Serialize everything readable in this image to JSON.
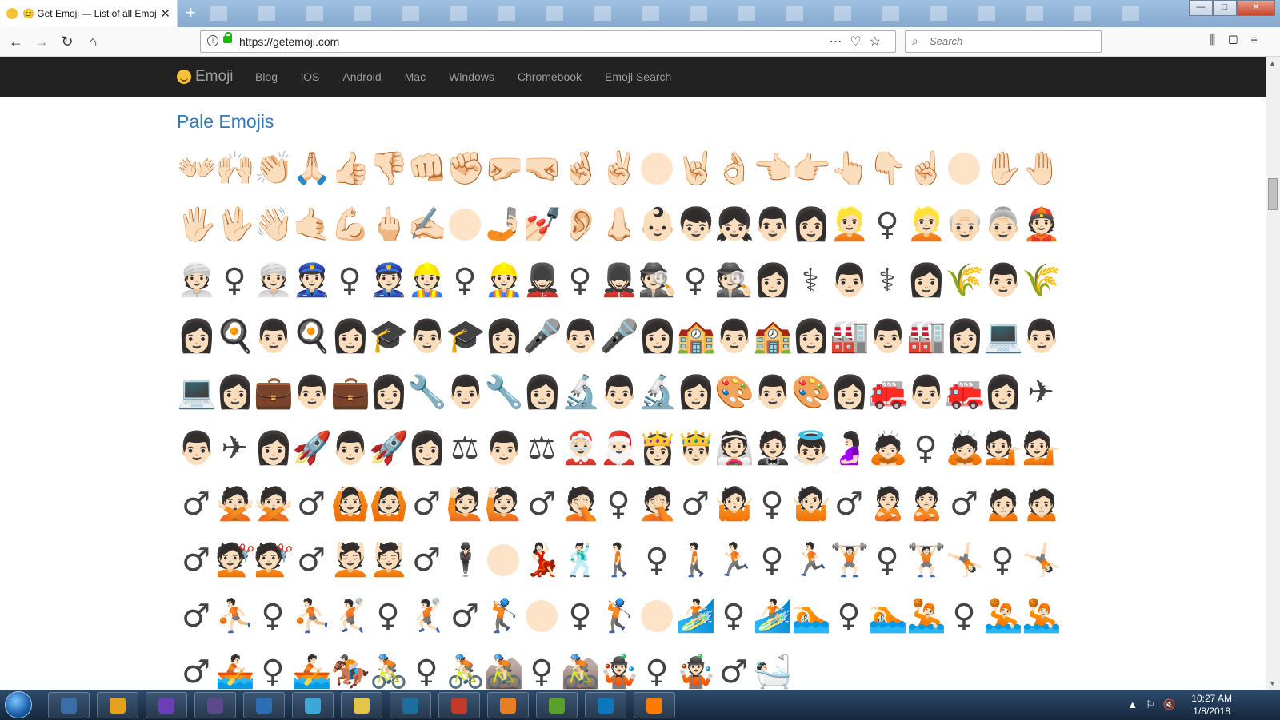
{
  "browser": {
    "tab_title": "😊 Get Emoji — List of all Emoji",
    "new_tab_label": "+",
    "url_host": "https://getemoji.com",
    "search_placeholder": "Search",
    "window_controls": [
      "—",
      "□",
      "✕"
    ]
  },
  "site": {
    "brand": "Emoji",
    "nav": [
      "Blog",
      "iOS",
      "Android",
      "Mac",
      "Windows",
      "Chromebook",
      "Emoji Search"
    ]
  },
  "page": {
    "title": "Pale Emojis",
    "emojis": [
      "👐🏻",
      "🙌🏻",
      "👏🏻",
      "🙏🏻",
      "👍🏻",
      "👎🏻",
      "👊🏻",
      "✊🏻",
      "🤛🏻",
      "🤜🏻",
      "🤞🏻",
      "✌🏻",
      "○",
      "🤘🏻",
      "👌🏻",
      "👈🏻",
      "👉🏻",
      "👆🏻",
      "👇🏻",
      "☝🏻",
      "○",
      "✋🏻",
      "🤚🏻",
      "🖐🏻",
      "🖖🏻",
      "👋🏻",
      "🤙🏻",
      "💪🏻",
      "🖕🏻",
      "✍🏻",
      "○",
      "🤳🏻",
      "💅🏻",
      "👂🏻",
      "👃🏻",
      "👶🏻",
      "👦🏻",
      "👧🏻",
      "👨🏻",
      "👩🏻",
      "👱🏻",
      "♀",
      "👱🏻",
      "👴🏻",
      "👵🏻",
      "👲🏻",
      "👳🏻",
      "♀",
      "👳🏻",
      "👮🏻",
      "♀",
      "👮🏻",
      "👷🏻",
      "♀",
      "👷🏻",
      "💂🏻",
      "♀",
      "💂🏻",
      "🕵🏻",
      "♀",
      "🕵🏻",
      "👩🏻",
      "⚕",
      "👨🏻",
      "⚕",
      "👩🏻",
      "🌾",
      "👨🏻",
      "🌾",
      "👩🏻",
      "🍳",
      "👨🏻",
      "🍳",
      "👩🏻",
      "🎓",
      "👨🏻",
      "🎓",
      "👩🏻",
      "🎤",
      "👨🏻",
      "🎤",
      "👩🏻",
      "🏫",
      "👨🏻",
      "🏫",
      "👩🏻",
      "🏭",
      "👨🏻",
      "🏭",
      "👩🏻",
      "💻",
      "👨🏻",
      "💻",
      "👩🏻",
      "💼",
      "👨🏻",
      "💼",
      "👩🏻",
      "🔧",
      "👨🏻",
      "🔧",
      "👩🏻",
      "🔬",
      "👨🏻",
      "🔬",
      "👩🏻",
      "🎨",
      "👨🏻",
      "🎨",
      "👩🏻",
      "🚒",
      "👨🏻",
      "🚒",
      "👩🏻",
      "✈",
      "👨🏻",
      "✈",
      "👩🏻",
      "🚀",
      "👨🏻",
      "🚀",
      "👩🏻",
      "⚖",
      "👨🏻",
      "⚖",
      "🤶🏻",
      "🎅🏻",
      "👸🏻",
      "🤴🏻",
      "👰🏻",
      "🤵🏻",
      "👼🏻",
      "🤰🏻",
      "🙇🏻",
      "♀",
      "🙇🏻",
      "💁🏻",
      "💁🏻",
      "♂",
      "🙅🏻",
      "🙅🏻",
      "♂",
      "🙆🏻",
      "🙆🏻",
      "♂",
      "🙋🏻",
      "🙋🏻",
      "♂",
      "🤦🏻",
      "♀",
      "🤦🏻",
      "♂",
      "🤷🏻",
      "♀",
      "🤷🏻",
      "♂",
      "🙎🏻",
      "🙎🏻",
      "♂",
      "🙍🏻",
      "🙍🏻",
      "♂",
      "💇🏻",
      "💇🏻",
      "♂",
      "💆🏻",
      "💆🏻",
      "♂",
      "🕴🏻",
      "○",
      "💃🏻",
      "🕺🏻",
      "🚶🏻",
      "♀",
      "🚶🏻",
      "🏃🏻",
      "♀",
      "🏃🏻",
      "🏋🏻",
      "♀",
      "🏋🏻",
      "🤸🏻",
      "♀",
      "🤸🏻",
      "♂",
      "⛹🏻",
      "♀",
      "⛹🏻",
      "🤾🏻",
      "♀",
      "🤾🏻",
      "♂",
      "🏌🏻",
      "○",
      "♀",
      "🏌🏻",
      "○",
      "🏄🏻",
      "♀",
      "🏄🏻",
      "🏊🏻",
      "♀",
      "🏊🏻",
      "🤽🏻",
      "♀",
      "🤽🏻",
      "🤽🏻",
      "♂",
      "🚣🏻",
      "♀",
      "🚣🏻",
      "🏇🏻",
      "🚴🏻",
      "♀",
      "🚴🏻",
      "🚵🏻",
      "♀",
      "🚵🏻",
      "🤹🏻",
      "♀",
      "🤹🏻",
      "♂",
      "🛀🏻"
    ]
  },
  "taskbar": {
    "time": "10:27 AM",
    "date": "1/8/2018",
    "tray_icons": [
      "▲",
      "⚐",
      "🔇"
    ],
    "app_colors": [
      "#3b6ea8",
      "#e3a21a",
      "#6a3fb5",
      "#5b4a8a",
      "#2c6fb3",
      "#3fa7d6",
      "#e2c64a",
      "#1e6fa0",
      "#c0392b",
      "#e67e22",
      "#5aa02c",
      "#0e76bc",
      "#ff7b00"
    ]
  }
}
